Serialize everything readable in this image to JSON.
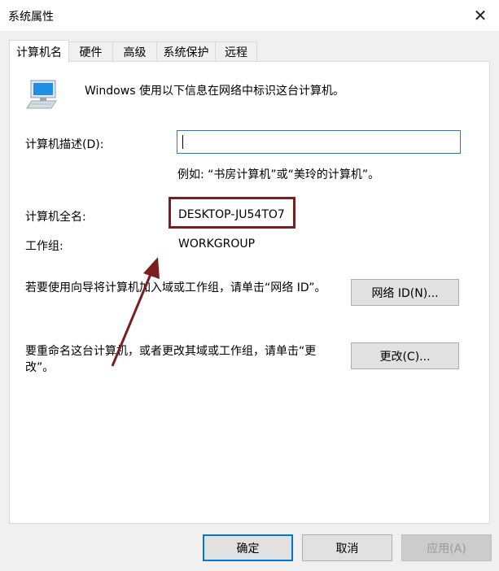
{
  "window": {
    "title": "系统属性",
    "close_glyph": "✕"
  },
  "tabs": [
    {
      "label": "计算机名",
      "active": true
    },
    {
      "label": "硬件",
      "active": false
    },
    {
      "label": "高级",
      "active": false
    },
    {
      "label": "系统保护",
      "active": false
    },
    {
      "label": "远程",
      "active": false
    }
  ],
  "computer_name_tab": {
    "icon": "computer-monitor-icon",
    "intro": "Windows 使用以下信息在网络中标识这台计算机。",
    "description_label": "计算机描述(D):",
    "description_value": "",
    "example": "例如: “书房计算机”或“美玲的计算机”。",
    "full_name_label": "计算机全名:",
    "full_name_value": "DESKTOP-JU54TO7",
    "workgroup_label": "工作组:",
    "workgroup_value": "WORKGROUP",
    "network_id_text": "若要使用向导将计算机加入域或工作组，请单击“网络 ID”。",
    "network_id_button": "网络 ID(N)...",
    "rename_text": "要重命名这台计算机，或者更改其域或工作组，请单击“更改”。",
    "change_button": "更改(C)..."
  },
  "annotation": {
    "highlight_color": "#7a1f1f",
    "arrow_color": "#7a1f1f"
  },
  "footer": {
    "ok": "确定",
    "cancel": "取消",
    "apply": "应用(A)"
  },
  "colors": {
    "dialog_bg": "#f0f0f0",
    "panel_bg": "#ffffff",
    "focus_border": "#0078d7"
  }
}
